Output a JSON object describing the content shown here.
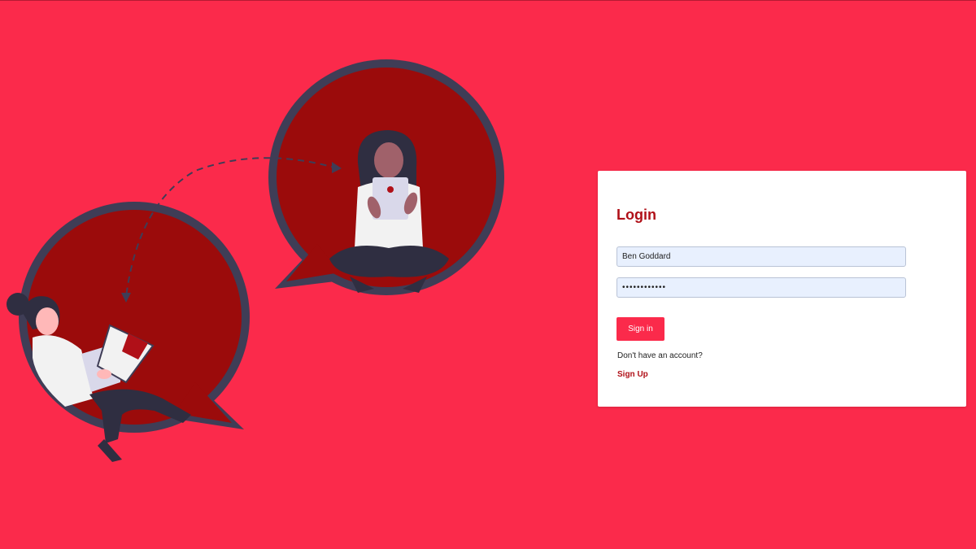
{
  "colors": {
    "background": "#fb2a4b",
    "accent_dark": "#b01018",
    "bubble_fill": "#9b0b0b",
    "bubble_outline": "#3f3d56",
    "card": "#ffffff",
    "input_fill": "#e8f0fe"
  },
  "illustration": {
    "icons": [
      "speech-bubble-left",
      "speech-bubble-right",
      "person-with-laptop",
      "person-with-tablet",
      "dashed-arrow"
    ]
  },
  "login": {
    "title": "Login",
    "username_value": "Ben Goddard",
    "password_value": "••••••••••••",
    "signin_label": "Sign in",
    "no_account_text": "Don't have an account?",
    "signup_label": "Sign Up"
  }
}
